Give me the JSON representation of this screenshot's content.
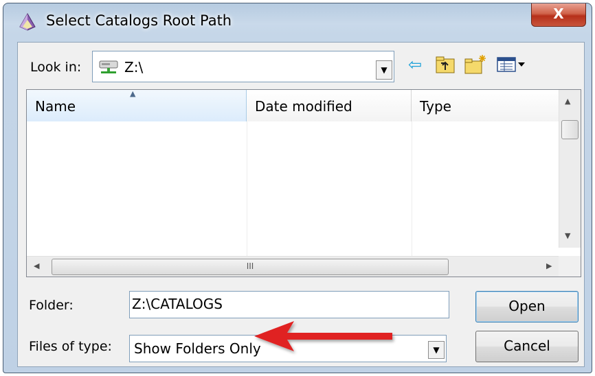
{
  "window": {
    "title": "Select Catalogs Root Path",
    "close_label": "X"
  },
  "lookin": {
    "label": "Look in:",
    "value": "Z:\\",
    "drive_icon": "network-drive-icon"
  },
  "toolbar": {
    "icons": [
      "back-arrow-icon",
      "up-folder-icon",
      "new-folder-icon",
      "view-menu-icon"
    ]
  },
  "listview": {
    "columns": [
      "Name",
      "Date modified",
      "Type"
    ],
    "sorted_column": "Name",
    "hscroll_grip": "III"
  },
  "folder": {
    "label": "Folder:",
    "value": "Z:\\CATALOGS"
  },
  "filetype": {
    "label": "Files of type:",
    "value": "Show Folders Only"
  },
  "buttons": {
    "open": "Open",
    "cancel": "Cancel"
  },
  "annotation": {
    "arrow_color": "#e02020"
  }
}
